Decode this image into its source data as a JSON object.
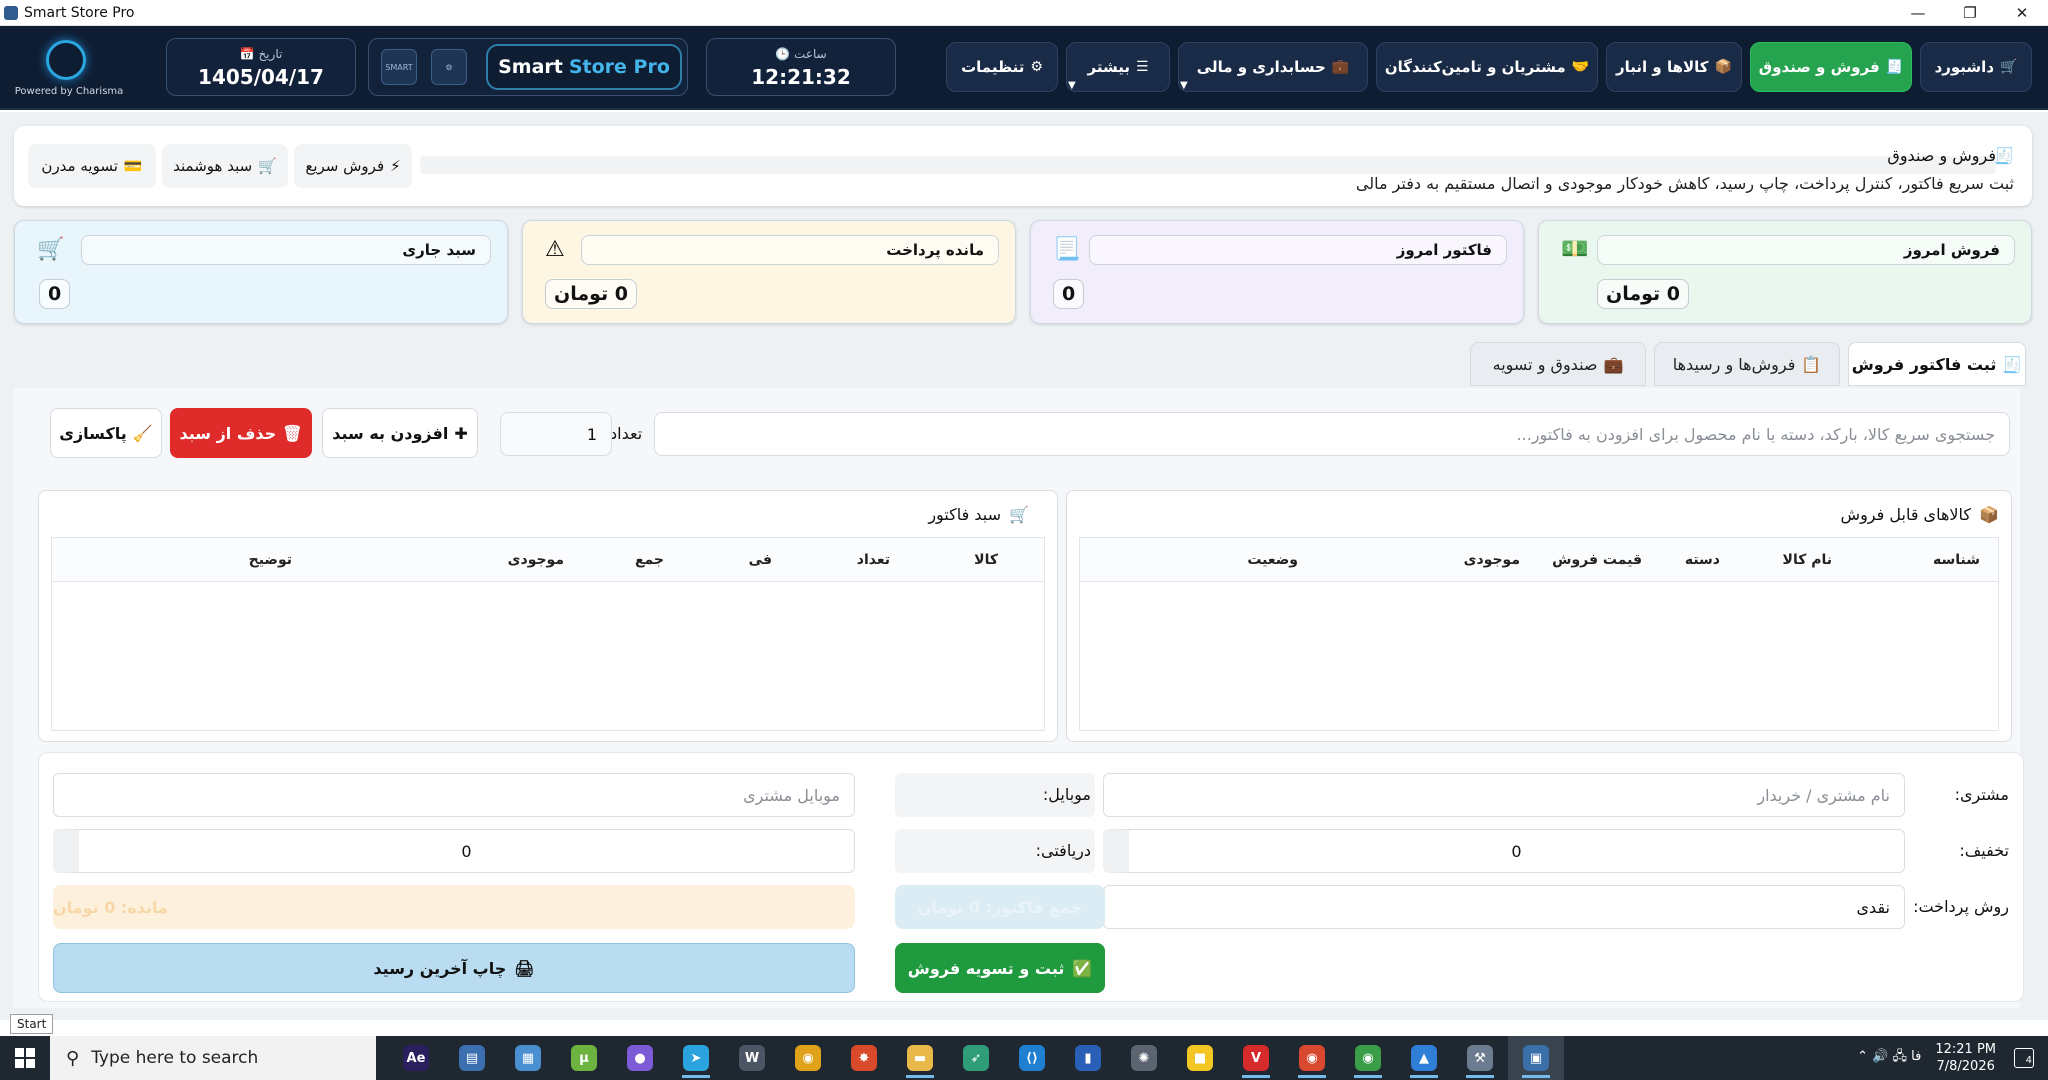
{
  "window": {
    "title": "Smart Store Pro",
    "min": "—",
    "restore": "❐",
    "close": "✕"
  },
  "header": {
    "powered_by": "Powered by Charisma",
    "mini_logo_text": "SMART",
    "date_label": "📅 تاریخ",
    "date_value": "1405/04/17",
    "brand_part1": "Smart",
    "brand_part2": "Store Pro",
    "time_label": "🕒 ساعت",
    "time_value": "12:21:32",
    "nav": [
      {
        "label": "داشبورد",
        "icon": "🛒"
      },
      {
        "label": "فروش و صندوق",
        "icon": "🧾"
      },
      {
        "label": "کالاها و انبار",
        "icon": "📦"
      },
      {
        "label": "مشتریان و تامین‌کنندگان",
        "icon": "🤝"
      },
      {
        "label": "حسابداری و مالی",
        "icon": "💼"
      },
      {
        "label": "بیشتر",
        "icon": "☰"
      },
      {
        "label": "تنظیمات",
        "icon": "⚙"
      }
    ]
  },
  "hero": {
    "title": "فروش و صندوق",
    "subtitle": "ثبت سریع فاکتور، کنترل پرداخت، چاپ رسید، کاهش خودکار موجودی و اتصال مستقیم به دفتر مالی",
    "quick_actions": [
      {
        "label": "فروش سریع",
        "icon": "⚡"
      },
      {
        "label": "سبد هوشمند",
        "icon": "🛒"
      },
      {
        "label": "تسویه مدرن",
        "icon": "💳"
      }
    ]
  },
  "stats": [
    {
      "label": "فروش امروز",
      "value": "0 تومان",
      "icon": "💵",
      "bg": "#e9f7ee"
    },
    {
      "label": "فاکتور امروز",
      "value": "0",
      "icon": "📃",
      "bg": "#f1edfb"
    },
    {
      "label": "مانده پرداخت",
      "value": "0 تومان",
      "icon": "⚠",
      "bg": "#fdf6e3"
    },
    {
      "label": "سبد جاری",
      "value": "0",
      "icon": "🛒",
      "bg": "#e8f6fb"
    }
  ],
  "tabs": [
    {
      "label": "ثبت فاکتور فروش",
      "icon": "🧾"
    },
    {
      "label": "فروش‌ها و رسیدها",
      "icon": "📋"
    },
    {
      "label": "صندوق و تسویه",
      "icon": "💼"
    }
  ],
  "toolbar": {
    "search_placeholder": "جستجوی سریع کالا، بارکد، دسته یا نام محصول برای افزودن به فاکتور...",
    "qty_label": "تعداد",
    "qty_value": "1",
    "add_label": "افزودن به سبد",
    "delete_label": "حذف از سبد",
    "clear_label": "پاکسازی"
  },
  "products": {
    "title": "کالاهای قابل فروش",
    "columns": [
      "شناسه",
      "نام کالا",
      "دسته",
      "قیمت فروش",
      "موجودی",
      "وضعیت"
    ]
  },
  "cart": {
    "title": "سبد فاکتور",
    "columns": [
      "کالا",
      "تعداد",
      "فی",
      "جمع",
      "موجودی",
      "توضیح"
    ]
  },
  "payment": {
    "customer_label": "مشتری:",
    "customer_placeholder": "نام مشتری / خریدار",
    "mobile_label": "موبایل:",
    "mobile_placeholder": "موبایل مشتری",
    "discount_label": "تخفیف:",
    "discount_value": "0",
    "received_label": "دریافتی:",
    "received_value": "0",
    "method_label": "روش پرداخت:",
    "method_value": "نقدی",
    "invoice_total": "جمع فاکتور: 0 تومان",
    "remaining": "مانده: 0 تومان",
    "submit_label": "ثبت و تسویه فروش",
    "print_label": "چاپ آخرین رسید"
  },
  "start_tooltip": "Start",
  "taskbar": {
    "search_placeholder": "Type here to search",
    "apps": [
      {
        "name": "after-effects-app",
        "glyph": "Ae",
        "color": "#2b1f5e"
      },
      {
        "name": "scanner-app",
        "glyph": "▤",
        "color": "#3c6fb0"
      },
      {
        "name": "gallery-app",
        "glyph": "▦",
        "color": "#4a8fd0"
      },
      {
        "name": "utorrent-app",
        "glyph": "µ",
        "color": "#6cb33f"
      },
      {
        "name": "mic-app",
        "glyph": "●",
        "color": "#7e5bd6"
      },
      {
        "name": "telegram-app",
        "glyph": "➤",
        "color": "#2aa3df"
      },
      {
        "name": "wordpress-app",
        "glyph": "W",
        "color": "#4b5563"
      },
      {
        "name": "chrome-app",
        "glyph": "◉",
        "color": "#e0a21a"
      },
      {
        "name": "star-app",
        "glyph": "✸",
        "color": "#d94a2a"
      },
      {
        "name": "file-explorer-app",
        "glyph": "▬",
        "color": "#e8b84a"
      },
      {
        "name": "cursor-app",
        "glyph": "➶",
        "color": "#2f9e78"
      },
      {
        "name": "vscode-app",
        "glyph": "⟨⟩",
        "color": "#1f7fd1"
      },
      {
        "name": "chart-app",
        "glyph": "▮",
        "color": "#2a5fb8"
      },
      {
        "name": "chatgpt-app",
        "glyph": "✺",
        "color": "#5b6470"
      },
      {
        "name": "note-app",
        "glyph": "■",
        "color": "#f3c623"
      },
      {
        "name": "vivaldi-app",
        "glyph": "V",
        "color": "#d62b2b"
      },
      {
        "name": "chrome-app-2",
        "glyph": "◉",
        "color": "#d8492f"
      },
      {
        "name": "chrome-app-3",
        "glyph": "◉",
        "color": "#3a9d4a"
      },
      {
        "name": "photos-app",
        "glyph": "▲",
        "color": "#2f7ed8"
      },
      {
        "name": "tools-app",
        "glyph": "⚒",
        "color": "#6b7c90"
      },
      {
        "name": "python-app",
        "glyph": "▣",
        "color": "#3b6fa8"
      }
    ],
    "tray": "⌃  🔊  🖧  فا",
    "clock_time": "12:21 PM",
    "clock_date": "7/8/2026",
    "notif": "4"
  }
}
